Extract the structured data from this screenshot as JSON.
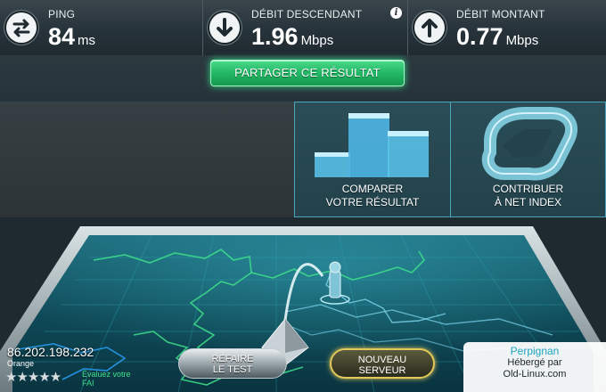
{
  "stats": {
    "ping": {
      "label": "PING",
      "value": "84",
      "unit": "ms",
      "icon": "exchange-arrows-icon"
    },
    "download": {
      "label": "DÉBIT DESCENDANT",
      "value": "1.96",
      "unit": "Mbps",
      "icon": "down-arrow-icon"
    },
    "upload": {
      "label": "DÉBIT MONTANT",
      "value": "0.77",
      "unit": "Mbps",
      "icon": "up-arrow-icon"
    },
    "info_glyph": "i"
  },
  "share_button": "PARTAGER CE RÉSULTAT",
  "tiles": {
    "compare": [
      "COMPARER",
      "VOTRE RÉSULTAT"
    ],
    "contribute": [
      "CONTRIBUER",
      "À NET INDEX"
    ]
  },
  "client": {
    "ip": "86.202.198.232",
    "isp": "Orange",
    "stars": "★★★★★",
    "rate_text": [
      "Évaluez votre",
      "FAI"
    ]
  },
  "buttons": {
    "retest": [
      "REFAIRE",
      "LE TEST"
    ],
    "new_server": [
      "NOUVEAU",
      "SERVEUR"
    ]
  },
  "server": {
    "city": "Perpignan",
    "hosted_label": "Hébergé par",
    "host": "Old-Linux.com"
  },
  "colors": {
    "accent_green": "#22b865",
    "accent_cyan": "#1ea3c1",
    "accent_gold": "#e3c95a",
    "map_line_green": "#3ee08a"
  }
}
